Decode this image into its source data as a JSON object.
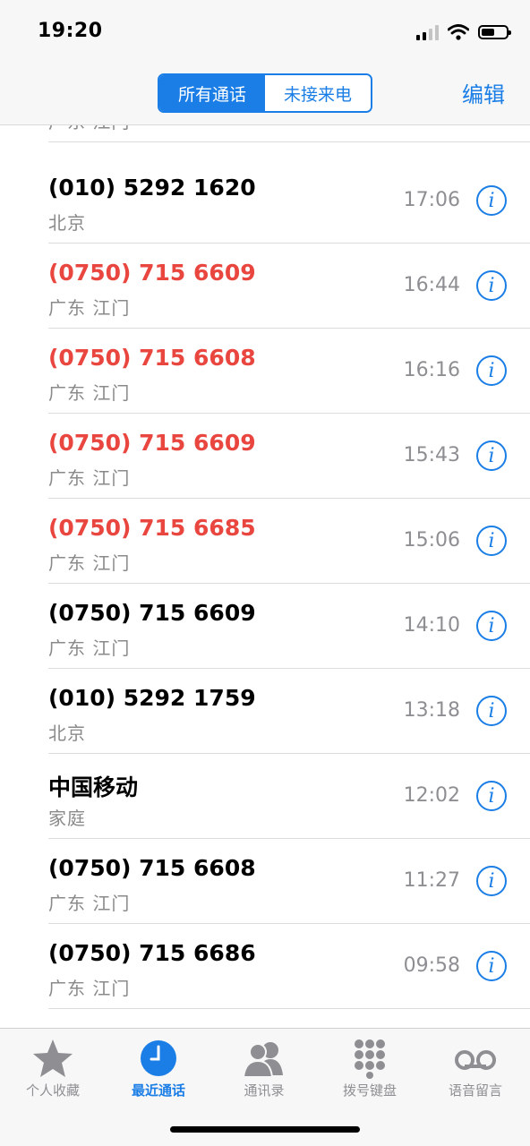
{
  "status_bar": {
    "time": "19:20"
  },
  "nav": {
    "segments": [
      {
        "label": "所有通话",
        "active": true
      },
      {
        "label": "未接来电",
        "active": false
      }
    ],
    "edit_label": "编辑"
  },
  "partial_row": {
    "location": "广东 江门"
  },
  "calls": [
    {
      "number": "(010) 5292 1620",
      "location": "北京",
      "time": "17:06",
      "missed": false
    },
    {
      "number": "(0750) 715 6609",
      "location": "广东 江门",
      "time": "16:44",
      "missed": true
    },
    {
      "number": "(0750) 715 6608",
      "location": "广东 江门",
      "time": "16:16",
      "missed": true
    },
    {
      "number": "(0750) 715 6609",
      "location": "广东 江门",
      "time": "15:43",
      "missed": true
    },
    {
      "number": "(0750) 715 6685",
      "location": "广东 江门",
      "time": "15:06",
      "missed": true
    },
    {
      "number": "(0750) 715 6609",
      "location": "广东 江门",
      "time": "14:10",
      "missed": false
    },
    {
      "number": "(010) 5292 1759",
      "location": "北京",
      "time": "13:18",
      "missed": false
    },
    {
      "number": "中国移动",
      "location": "家庭",
      "time": "12:02",
      "missed": false
    },
    {
      "number": "(0750) 715 6608",
      "location": "广东 江门",
      "time": "11:27",
      "missed": false
    },
    {
      "number": "(0750) 715 6686",
      "location": "广东 江门",
      "time": "09:58",
      "missed": false
    }
  ],
  "tabs": [
    {
      "label": "个人收藏",
      "icon": "star-icon",
      "active": false
    },
    {
      "label": "最近通话",
      "icon": "clock-icon",
      "active": true
    },
    {
      "label": "通讯录",
      "icon": "contacts-icon",
      "active": false
    },
    {
      "label": "拨号键盘",
      "icon": "keypad-icon",
      "active": false
    },
    {
      "label": "语音留言",
      "icon": "voicemail-icon",
      "active": false
    }
  ],
  "colors": {
    "accent": "#1a7ee6",
    "missed": "#e9463f",
    "secondary": "#8e8e93"
  }
}
